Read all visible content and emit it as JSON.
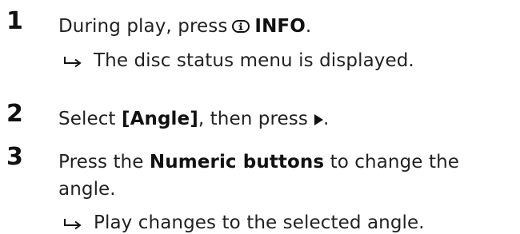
{
  "steps": [
    {
      "number": "1",
      "line1_pre": "During play, press",
      "button_icon": "info-icon",
      "line1_bold": "INFO",
      "line1_post": ".",
      "result": "The disc status menu is displayed."
    },
    {
      "number": "2",
      "line1_pre": "Select",
      "line1_bold": "[Angle]",
      "line1_post": ", then press",
      "button_icon": "play-right-icon",
      "line1_end": "."
    },
    {
      "number": "3",
      "line1_pre": "Press the",
      "line1_bold": "Numeric buttons",
      "line1_post": "to change the",
      "line2": "angle.",
      "result": "Play changes to the selected angle."
    }
  ]
}
